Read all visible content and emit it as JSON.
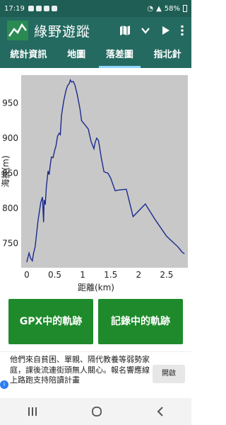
{
  "status": {
    "time": "17:19",
    "battery": "58%"
  },
  "app": {
    "title": "綠野遊蹤"
  },
  "tabs": [
    {
      "label": "統計資訊",
      "active": false
    },
    {
      "label": "地圖",
      "active": false
    },
    {
      "label": "落差圖",
      "active": true
    },
    {
      "label": "指北針",
      "active": false
    }
  ],
  "chart_data": {
    "type": "line",
    "xlabel": "距離(km)",
    "ylabel": "海拔(m)",
    "xlim": [
      -0.1,
      2.88
    ],
    "ylim": [
      715,
      990
    ],
    "xticks": [
      0,
      0.5,
      1,
      1.5,
      2,
      2.5
    ],
    "xtick_labels": [
      "0",
      "0.5",
      "1",
      "1.5",
      "2",
      "2.5"
    ],
    "yticks": [
      750,
      800,
      850,
      900,
      950
    ],
    "ytick_labels": [
      "750",
      "800",
      "850",
      "900",
      "950"
    ],
    "grid": false,
    "background": "#c8c8c8",
    "line_color": "#1b2a8f",
    "series": [
      {
        "x": [
          0,
          0.04,
          0.07,
          0.1,
          0.12,
          0.15,
          0.2,
          0.25,
          0.28,
          0.3,
          0.31,
          0.33,
          0.35,
          0.38,
          0.4,
          0.42,
          0.44,
          0.47,
          0.5,
          0.52,
          0.55,
          0.58,
          0.6,
          0.62,
          0.66,
          0.7,
          0.73,
          0.76,
          0.78,
          0.8,
          0.83,
          0.86,
          0.9,
          0.95,
          0.98,
          1.03,
          1.1,
          1.15,
          1.2,
          1.22,
          1.25,
          1.28,
          1.3,
          1.33,
          1.38,
          1.45,
          1.5,
          1.58,
          1.65,
          1.78,
          1.9,
          2.12,
          2.3,
          2.5,
          2.7,
          2.78,
          2.82
        ],
        "y": [
          723,
          736,
          728,
          725,
          735,
          745,
          782,
          808,
          816,
          780,
          812,
          805,
          830,
          853,
          848,
          862,
          873,
          872,
          883,
          888,
          903,
          907,
          905,
          932,
          953,
          968,
          975,
          978,
          983,
          980,
          981,
          976,
          963,
          942,
          925,
          920,
          913,
          895,
          885,
          893,
          900,
          897,
          888,
          873,
          852,
          850,
          843,
          825,
          826,
          827,
          788,
          806,
          783,
          760,
          745,
          737,
          735
        ]
      }
    ]
  },
  "buttons": {
    "gpx_track": "GPX中的軌跡",
    "recorded_track": "記錄中的軌跡"
  },
  "ad": {
    "text": "他們來自貧困、單親、隔代教養等弱勢家庭，課後流連街頭無人關心。報名響應線上路跑支持陪讀計畫",
    "button": "開啟",
    "badge": "i"
  }
}
